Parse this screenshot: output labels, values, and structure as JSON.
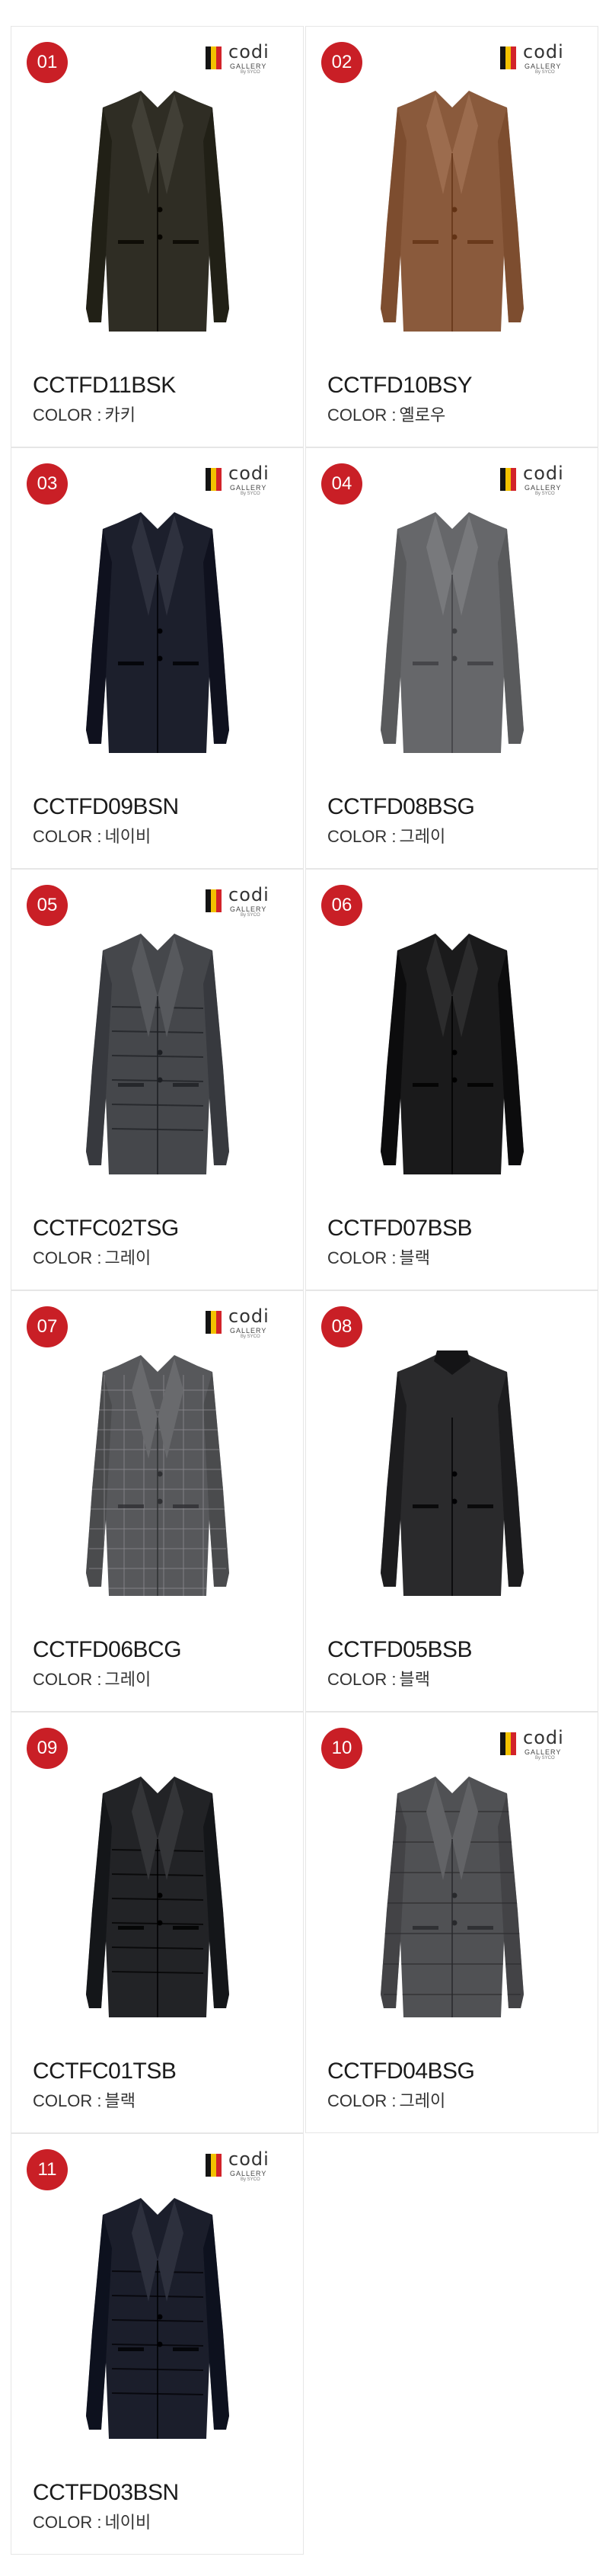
{
  "brand": {
    "word": "codi",
    "sub": "GALLERY",
    "by": "By SYCO",
    "flag_colors": [
      "#141414",
      "#f2c200",
      "#d2232a"
    ]
  },
  "color_label": "COLOR :",
  "badge_color": "#c91f26",
  "products": [
    {
      "num": "01",
      "code": "CCTFD11BSK",
      "color": "카키",
      "logo": true,
      "coat": "#2f2d24",
      "style": "single"
    },
    {
      "num": "02",
      "code": "CCTFD10BSY",
      "color": "옐로우",
      "logo": true,
      "coat": "#8a5a3c",
      "style": "single"
    },
    {
      "num": "03",
      "code": "CCTFD09BSN",
      "color": "네이비",
      "logo": true,
      "coat": "#1c1f2c",
      "style": "single"
    },
    {
      "num": "04",
      "code": "CCTFD08BSG",
      "color": "그레이",
      "logo": true,
      "coat": "#66676a",
      "style": "single"
    },
    {
      "num": "05",
      "code": "CCTFC02TSG",
      "color": "그레이",
      "logo": true,
      "coat": "#45474b",
      "style": "padded"
    },
    {
      "num": "06",
      "code": "CCTFD07BSB",
      "color": "블랙",
      "logo": false,
      "coat": "#1a1a1b",
      "style": "single"
    },
    {
      "num": "07",
      "code": "CCTFD06BCG",
      "color": "그레이",
      "logo": true,
      "coat": "#57585b",
      "style": "check"
    },
    {
      "num": "08",
      "code": "CCTFD05BSB",
      "color": "블랙",
      "logo": false,
      "coat": "#2a2a2c",
      "style": "stand"
    },
    {
      "num": "09",
      "code": "CCTFC01TSB",
      "color": "블랙",
      "logo": false,
      "coat": "#222326",
      "style": "padded"
    },
    {
      "num": "10",
      "code": "CCTFD04BSG",
      "color": "그레이",
      "logo": true,
      "coat": "#505154",
      "style": "tweed"
    },
    {
      "num": "11",
      "code": "CCTFD03BSN",
      "color": "네이비",
      "logo": true,
      "coat": "#1b1e2b",
      "style": "padded"
    }
  ]
}
